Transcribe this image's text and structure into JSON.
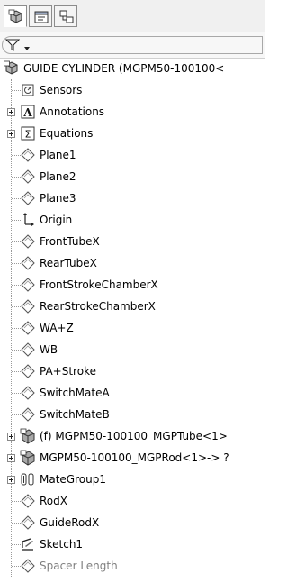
{
  "tabs": [
    {
      "name": "featuremanager-tab",
      "icon": "featuremanager-icon"
    },
    {
      "name": "propertymanager-tab",
      "icon": "propertymanager-icon"
    },
    {
      "name": "configurationmanager-tab",
      "icon": "configurationmanager-icon"
    }
  ],
  "filter": {
    "icon": "filter-icon"
  },
  "tree": {
    "root": "GUIDE CYLINDER  (MGPM50-100100<",
    "items": [
      {
        "label": "Sensors",
        "icon": "sensors-icon",
        "expandable": false
      },
      {
        "label": "Annotations",
        "icon": "annotations-icon",
        "expandable": true
      },
      {
        "label": "Equations",
        "icon": "equations-icon",
        "expandable": true
      },
      {
        "label": "Plane1",
        "icon": "plane-icon",
        "expandable": false
      },
      {
        "label": "Plane2",
        "icon": "plane-icon",
        "expandable": false
      },
      {
        "label": "Plane3",
        "icon": "plane-icon",
        "expandable": false
      },
      {
        "label": "Origin",
        "icon": "origin-icon",
        "expandable": false
      },
      {
        "label": "FrontTubeX",
        "icon": "plane-icon",
        "expandable": false
      },
      {
        "label": "RearTubeX",
        "icon": "plane-icon",
        "expandable": false
      },
      {
        "label": "FrontStrokeChamberX",
        "icon": "plane-icon",
        "expandable": false
      },
      {
        "label": "RearStrokeChamberX",
        "icon": "plane-icon",
        "expandable": false
      },
      {
        "label": "WA+Z",
        "icon": "plane-icon",
        "expandable": false
      },
      {
        "label": "WB",
        "icon": "plane-icon",
        "expandable": false
      },
      {
        "label": "PA+Stroke",
        "icon": "plane-icon",
        "expandable": false
      },
      {
        "label": "SwitchMateA",
        "icon": "plane-icon",
        "expandable": false
      },
      {
        "label": "SwitchMateB",
        "icon": "plane-icon",
        "expandable": false
      },
      {
        "label": "(f) MGPM50-100100_MGPTube<1>",
        "icon": "part-icon",
        "expandable": true
      },
      {
        "label": "MGPM50-100100_MGPRod<1>-> ?",
        "icon": "part-icon",
        "expandable": true
      },
      {
        "label": "MateGroup1",
        "icon": "mategroup-icon",
        "expandable": true
      },
      {
        "label": "RodX",
        "icon": "plane-icon",
        "expandable": false
      },
      {
        "label": "GuideRodX",
        "icon": "plane-icon",
        "expandable": false
      },
      {
        "label": "Sketch1",
        "icon": "sketch-icon",
        "expandable": false
      },
      {
        "label": "Spacer Length",
        "icon": "plane-icon",
        "expandable": false,
        "dimmed": true
      }
    ]
  }
}
